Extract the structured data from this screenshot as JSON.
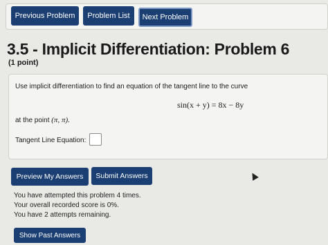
{
  "nav": {
    "previous_label": "Previous Problem",
    "list_label": "Problem List",
    "next_label": "Next Problem"
  },
  "problem": {
    "title": "3.5 - Implicit Differentiation: Problem 6",
    "points": "(1 point)",
    "statement": "Use implicit differentiation to find an equation of the tangent line to the curve",
    "equation": "sin(x + y) = 8x − 8y",
    "point_prefix": "at the point ",
    "point_value": "(π, π).",
    "answer_label": "Tangent Line Equation:",
    "answer_value": ""
  },
  "actions": {
    "preview_label": "Preview My Answers",
    "submit_label": "Submit Answers",
    "past_label": "Show Past Answers"
  },
  "status": {
    "attempted": "You have attempted this problem 4 times.",
    "score": "Your overall recorded score is 0%.",
    "remaining": "You have 2 attempts remaining."
  },
  "colors": {
    "button_bg": "#1b3f73",
    "panel_bg": "#f4f4f2",
    "page_bg": "#e9e9e6"
  }
}
